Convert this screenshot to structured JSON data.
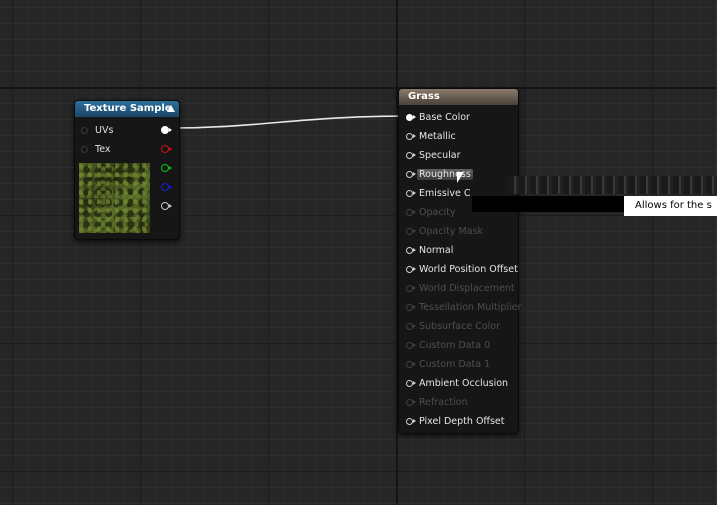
{
  "texture_node": {
    "title": "Texture Sample",
    "inputs": [
      {
        "label": "UVs"
      },
      {
        "label": "Tex"
      }
    ],
    "outputs": [
      {
        "color": "#ffffff",
        "filled": true,
        "name": "rgb"
      },
      {
        "color": "#d01010",
        "filled": false,
        "name": "r"
      },
      {
        "color": "#10c010",
        "filled": false,
        "name": "g"
      },
      {
        "color": "#1020d0",
        "filled": false,
        "name": "b"
      },
      {
        "color": "#c8c8c8",
        "filled": false,
        "name": "a"
      }
    ]
  },
  "material_node": {
    "title": "Grass",
    "pins": [
      {
        "label": "Base Color",
        "state": "connected"
      },
      {
        "label": "Metallic",
        "state": "active"
      },
      {
        "label": "Specular",
        "state": "active"
      },
      {
        "label": "Roughness",
        "state": "hover"
      },
      {
        "label": "Emissive C",
        "state": "active"
      },
      {
        "label": "Opacity",
        "state": "inactive"
      },
      {
        "label": "Opacity Mask",
        "state": "inactive"
      },
      {
        "label": "Normal",
        "state": "active"
      },
      {
        "label": "World Position Offset",
        "state": "active"
      },
      {
        "label": "World Displacement",
        "state": "inactive"
      },
      {
        "label": "Tessellation Multiplier",
        "state": "inactive"
      },
      {
        "label": "Subsurface Color",
        "state": "inactive"
      },
      {
        "label": "Custom Data 0",
        "state": "inactive"
      },
      {
        "label": "Custom Data 1",
        "state": "inactive"
      },
      {
        "label": "Ambient Occlusion",
        "state": "active"
      },
      {
        "label": "Refraction",
        "state": "inactive"
      },
      {
        "label": "Pixel Depth Offset",
        "state": "active"
      }
    ]
  },
  "tooltip": {
    "text": "Allows for the s"
  },
  "colors": {
    "graph_background": "#262626",
    "texture_header": "#2d6f9d",
    "material_header": "#8b7b6c",
    "wire": "#ffffff"
  }
}
